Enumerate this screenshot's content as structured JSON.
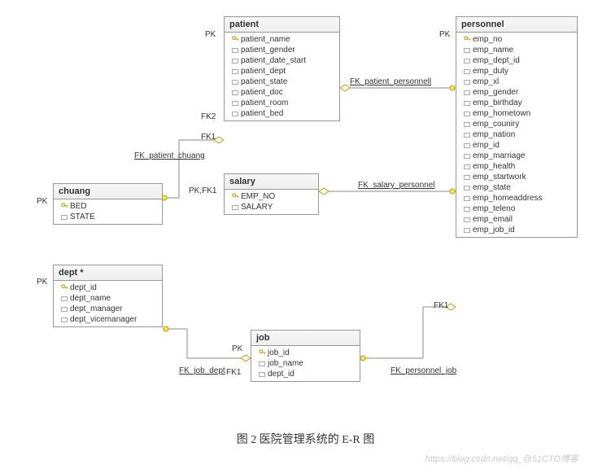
{
  "caption": "图 2 医院管理系统的 E-R 图",
  "watermark": "https://blog.csdn.net/qq_@51CTO博客",
  "labels": {
    "pk_patient": "PK",
    "fk2_patient": "FK2",
    "fk1_patient": "FK1",
    "pk_chuang": "PK",
    "pkfk1_salary": "PK,FK1",
    "pk_dept": "PK",
    "pk_job": "PK",
    "fk1_job": "FK1",
    "pk_personnel": "PK",
    "fk1_personnel": "FK1"
  },
  "connLabels": {
    "fk_patient_personnel": "FK_patient_personnell",
    "fk_patient_chuang": "FK_patient_chuang",
    "fk_salary_personnel": "FK_salary_personnel",
    "fk_job_dept": "FK_job_dept",
    "fk_personnel_job": "FK_personnel_job"
  },
  "entities": {
    "patient": {
      "title": "patient",
      "fields": [
        {
          "name": "patient_name",
          "pk": true
        },
        {
          "name": "patient_gender"
        },
        {
          "name": "patient_date_start"
        },
        {
          "name": "patient_dept"
        },
        {
          "name": "patient_state"
        },
        {
          "name": "patient_doc"
        },
        {
          "name": "patient_room"
        },
        {
          "name": "patient_bed"
        }
      ]
    },
    "personnel": {
      "title": "personnel",
      "fields": [
        {
          "name": "emp_no",
          "pk": true
        },
        {
          "name": "emp_name"
        },
        {
          "name": "emp_dept_id"
        },
        {
          "name": "emp_duty"
        },
        {
          "name": "emp_xl"
        },
        {
          "name": "emp_gender"
        },
        {
          "name": "emp_birthday"
        },
        {
          "name": "emp_hometown"
        },
        {
          "name": "emp_couniry"
        },
        {
          "name": "emp_nation"
        },
        {
          "name": "emp_id"
        },
        {
          "name": "emp_marriage"
        },
        {
          "name": "emp_health"
        },
        {
          "name": "emp_startwork"
        },
        {
          "name": "emp_state"
        },
        {
          "name": "emp_homeaddress"
        },
        {
          "name": "emp_teleno"
        },
        {
          "name": "emp_email"
        },
        {
          "name": "emp_job_id"
        }
      ]
    },
    "chuang": {
      "title": "chuang",
      "fields": [
        {
          "name": "BED",
          "pk": true
        },
        {
          "name": "STATE"
        }
      ]
    },
    "salary": {
      "title": "salary",
      "fields": [
        {
          "name": "EMP_NO",
          "pk": true
        },
        {
          "name": "SALARY"
        }
      ]
    },
    "dept": {
      "title": "dept *",
      "fields": [
        {
          "name": "dept_id",
          "pk": true
        },
        {
          "name": "dept_name"
        },
        {
          "name": "dept_manager"
        },
        {
          "name": "dept_vicemanager"
        }
      ]
    },
    "job": {
      "title": "job",
      "fields": [
        {
          "name": "job_id",
          "pk": true
        },
        {
          "name": "job_name"
        },
        {
          "name": "dept_id"
        }
      ]
    }
  }
}
